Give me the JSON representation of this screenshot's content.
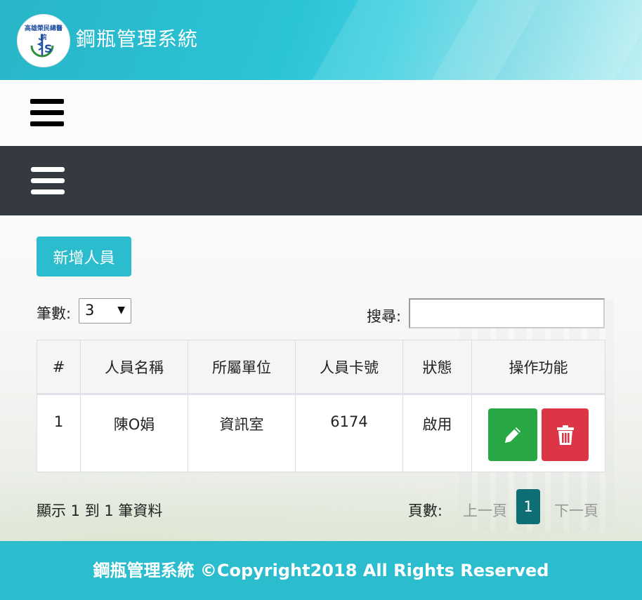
{
  "header": {
    "title": "鋼瓶管理系統",
    "logo_text": "高雄榮民總醫院"
  },
  "toolbar": {
    "add_label": "新增人員"
  },
  "length": {
    "label": "筆數:",
    "value": "3"
  },
  "search": {
    "label": "搜尋:",
    "value": ""
  },
  "table": {
    "headers": [
      "#",
      "人員名稱",
      "所屬單位",
      "人員卡號",
      "狀態",
      "操作功能"
    ],
    "rows": [
      {
        "no": "1",
        "name": "陳O娟",
        "unit": "資訊室",
        "card": "6174",
        "status": "啟用"
      }
    ]
  },
  "info": "顯示 1 到 1 筆資料",
  "pager": {
    "label": "頁數:",
    "prev": "上一頁",
    "current": "1",
    "next": "下一頁"
  },
  "footer": "鋼瓶管理系統 ©Copyright2018 All Rights Reserved",
  "colors": {
    "accent": "#2bbdcd",
    "dark_nav": "#343a40",
    "edit": "#28a745",
    "delete": "#dc3545",
    "page_active": "#0d6e73"
  },
  "icons": {
    "edit": "pencil-icon",
    "delete": "trash-icon",
    "menu": "hamburger-icon"
  }
}
